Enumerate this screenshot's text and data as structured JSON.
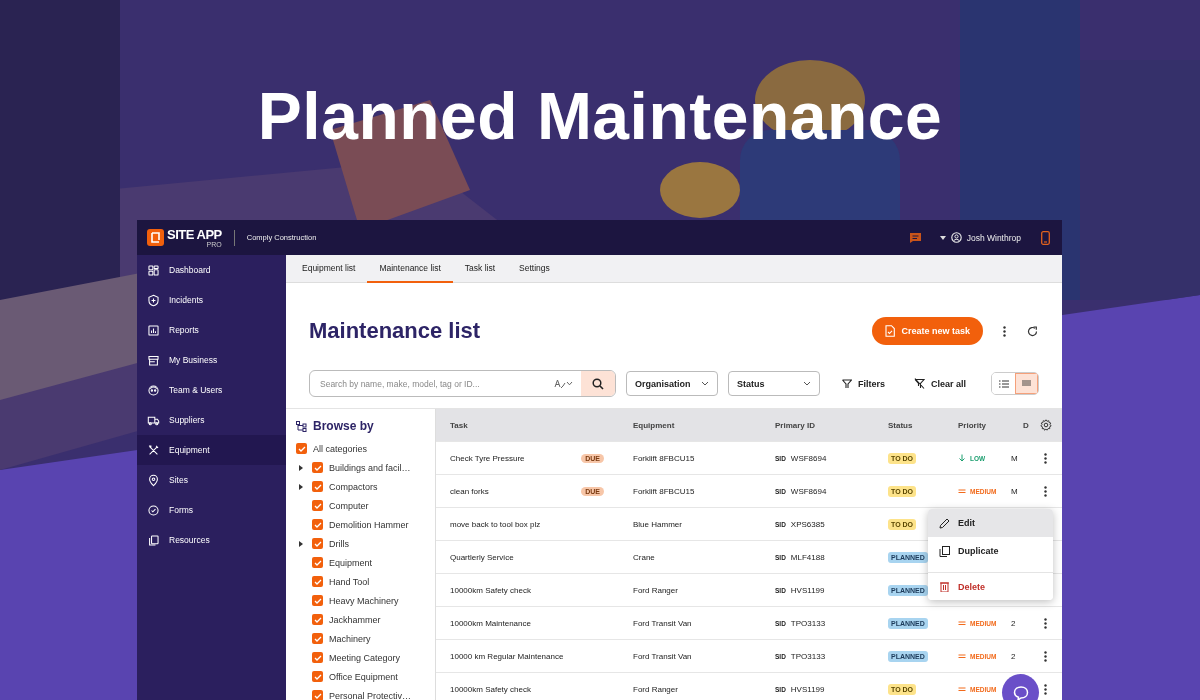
{
  "headline": "Planned Maintenance",
  "topbar": {
    "brand": "SITE APP",
    "brand_tag": "PRO",
    "organisation": "Comply Construction",
    "user": "Josh Winthrop"
  },
  "sidebar": {
    "items": [
      {
        "label": "Dashboard",
        "selected": false
      },
      {
        "label": "Incidents",
        "selected": false
      },
      {
        "label": "Reports",
        "selected": false
      },
      {
        "label": "My Business",
        "selected": false
      },
      {
        "label": "Team & Users",
        "selected": false
      },
      {
        "label": "Suppliers",
        "selected": false
      },
      {
        "label": "Equipment",
        "selected": true
      },
      {
        "label": "Sites",
        "selected": false
      },
      {
        "label": "Forms",
        "selected": false
      },
      {
        "label": "Resources",
        "selected": false
      }
    ]
  },
  "tabs": [
    {
      "label": "Equipment list",
      "selected": false
    },
    {
      "label": "Maintenance list",
      "selected": true
    },
    {
      "label": "Task list",
      "selected": false
    },
    {
      "label": "Settings",
      "selected": false
    }
  ],
  "page": {
    "title": "Maintenance list",
    "create_button": "Create new task"
  },
  "toolbar": {
    "search": {
      "placeholder": "Search by name, make, model, tag or ID..."
    },
    "dropdowns": [
      {
        "label": "Organisation"
      },
      {
        "label": "Status"
      }
    ],
    "filters": "Filters",
    "clear": "Clear all",
    "views": [
      {
        "kind": "list",
        "selected": false
      },
      {
        "kind": "compact",
        "selected": true
      }
    ]
  },
  "browse": {
    "title": "Browse by",
    "categories": [
      {
        "label": "All categories",
        "checked": true,
        "children": [
          {
            "label": "Buildings and facil…",
            "checked": true,
            "expandable": true
          },
          {
            "label": "Compactors",
            "checked": true,
            "expandable": true
          },
          {
            "label": "Computer",
            "checked": true,
            "expandable": false
          },
          {
            "label": "Demolition Hammer",
            "checked": true,
            "expandable": false
          },
          {
            "label": "Drills",
            "checked": true,
            "expandable": true
          },
          {
            "label": "Equipment",
            "checked": true,
            "expandable": false
          },
          {
            "label": "Hand Tool",
            "checked": true,
            "expandable": false
          },
          {
            "label": "Heavy Machinery",
            "checked": true,
            "expandable": false
          },
          {
            "label": "Jackhammer",
            "checked": true,
            "expandable": false
          },
          {
            "label": "Machinery",
            "checked": true,
            "expandable": false
          },
          {
            "label": "Meeting Category",
            "checked": true,
            "expandable": false
          },
          {
            "label": "Office Equipment",
            "checked": true,
            "expandable": false
          },
          {
            "label": "Personal Protectiv…",
            "checked": true,
            "expandable": false
          }
        ]
      }
    ]
  },
  "table": {
    "columns": [
      "Task",
      "Equipment",
      "Primary ID",
      "Status",
      "Priority",
      "D"
    ],
    "rows": [
      {
        "task": "Check Tyre Pressure",
        "due": "DUE",
        "equipment": "Forklift 8FBCU15",
        "sid_label": "SID",
        "primary_id": "WSF8694",
        "status": {
          "label": "TO DO",
          "kind": "todo"
        },
        "priority": {
          "label": "LOW",
          "kind": "low"
        },
        "column_6": "M",
        "actions": true
      },
      {
        "task": "clean forks",
        "due": "DUE",
        "equipment": "Forklift 8FBCU15",
        "sid_label": "SID",
        "primary_id": "WSF8694",
        "status": {
          "label": "TO DO",
          "kind": "todo"
        },
        "priority": {
          "label": "MEDIUM",
          "kind": "medium"
        },
        "column_6": "M",
        "actions": true
      },
      {
        "task": "move back to tool box plz",
        "equipment": "Blue Hammer",
        "sid_label": "SID",
        "primary_id": "XPS6385",
        "status": {
          "label": "TO DO",
          "kind": "todo"
        }
      },
      {
        "task": "Quartlerly Service",
        "equipment": "Crane",
        "sid_label": "SID",
        "primary_id": "MLF4188",
        "status": {
          "label": "PLANNED",
          "kind": "planned"
        }
      },
      {
        "task": "10000km Safety check",
        "equipment": "Ford Ranger",
        "sid_label": "SID",
        "primary_id": "HVS1199",
        "status": {
          "label": "PLANNED",
          "kind": "planned"
        }
      },
      {
        "task": "10000km Maintenance",
        "equipment": "Ford Transit Van",
        "sid_label": "SID",
        "primary_id": "TPO3133",
        "status": {
          "label": "PLANNED",
          "kind": "planned"
        },
        "priority": {
          "label": "MEDIUM",
          "kind": "medium"
        },
        "column_6": "2",
        "actions": true
      },
      {
        "task": "10000 km Regular Maintenance",
        "equipment": "Ford Transit Van",
        "sid_label": "SID",
        "primary_id": "TPO3133",
        "status": {
          "label": "PLANNED",
          "kind": "planned"
        },
        "priority": {
          "label": "MEDIUM",
          "kind": "medium"
        },
        "column_6": "2",
        "actions": true
      },
      {
        "task": "10000km Safety check",
        "equipment": "Ford Ranger",
        "sid_label": "SID",
        "primary_id": "HVS1199",
        "status": {
          "label": "TO DO",
          "kind": "todo"
        },
        "priority": {
          "label": "MEDIUM",
          "kind": "medium"
        },
        "actions": true
      }
    ]
  },
  "context_menu": {
    "items": [
      {
        "label": "Edit",
        "kind": "edit",
        "selected": true
      },
      {
        "label": "Duplicate",
        "kind": "duplicate",
        "selected": false
      },
      {
        "label": "Delete",
        "kind": "delete",
        "selected": false
      }
    ]
  }
}
